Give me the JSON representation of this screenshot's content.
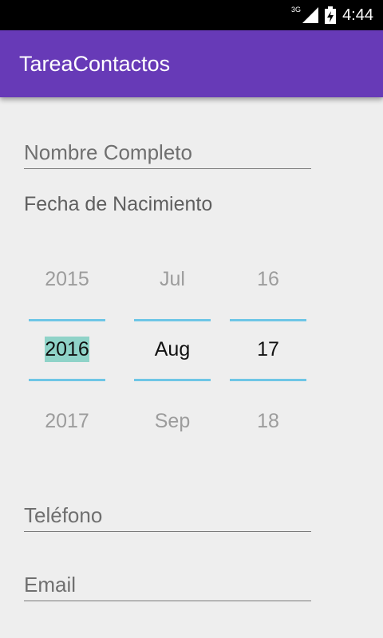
{
  "status_bar": {
    "network": "3G",
    "time": "4:44"
  },
  "app_bar": {
    "title": "TareaContactos"
  },
  "form": {
    "nombre_placeholder": "Nombre Completo",
    "fecha_label": "Fecha de Nacimiento",
    "telefono_placeholder": "Teléfono",
    "email_placeholder": "Email"
  },
  "date_picker": {
    "year": {
      "prev": "2015",
      "selected": "2016",
      "next": "2017"
    },
    "month": {
      "prev": "Jul",
      "selected": "Aug",
      "next": "Sep"
    },
    "day": {
      "prev": "16",
      "selected": "17",
      "next": "18"
    }
  },
  "colors": {
    "app_bar": "#673ab7",
    "picker_divider": "#6ec6e6",
    "selection_highlight": "#8fd3c8"
  }
}
